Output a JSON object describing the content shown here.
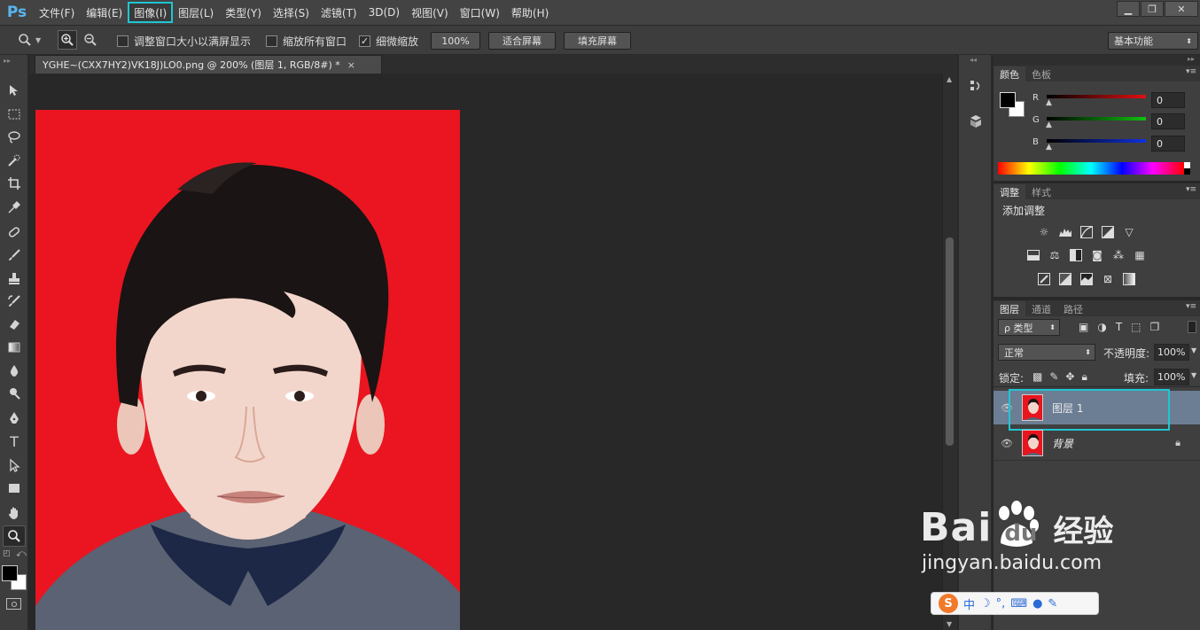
{
  "app": {
    "logo": "Ps"
  },
  "menu": [
    "文件(F)",
    "编辑(E)",
    "图像(I)",
    "图层(L)",
    "类型(Y)",
    "选择(S)",
    "滤镜(T)",
    "3D(D)",
    "视图(V)",
    "窗口(W)",
    "帮助(H)"
  ],
  "menu_highlighted": "图像(I)",
  "window_controls": {
    "minimize": "▁",
    "restore": "❐",
    "close": "✕"
  },
  "options": {
    "resize_windows_label": "调整窗口大小以满屏显示",
    "resize_windows_checked": false,
    "zoom_all_label": "缩放所有窗口",
    "zoom_all_checked": false,
    "scrubby_zoom_label": "细微缩放",
    "scrubby_zoom_checked": true,
    "actual_pixels_button": "100%",
    "fit_screen_button": "适合屏幕",
    "fill_screen_button": "填充屏幕",
    "workspace": "基本功能"
  },
  "document": {
    "tab_title": "YGHE~(CXX7HY2)VK18J)LO0.png @ 200% (图层 1, RGB/8#) *",
    "close": "×"
  },
  "color_panel": {
    "tabs": [
      "颜色",
      "色板"
    ],
    "active_tab": "颜色",
    "foreground": "#000000",
    "background": "#ffffff",
    "sliders": [
      {
        "label": "R",
        "value": "0",
        "color": "#e01010"
      },
      {
        "label": "G",
        "value": "0",
        "color": "#10c010"
      },
      {
        "label": "B",
        "value": "0",
        "color": "#1030e0"
      }
    ]
  },
  "adjustments_panel": {
    "tabs": [
      "调整",
      "样式"
    ],
    "active_tab": "调整",
    "title": "添加调整",
    "rows": [
      [
        "brightness-icon",
        "levels-icon",
        "curves-icon",
        "exposure-icon",
        "vibrance-icon"
      ],
      [
        "hue-saturation-icon",
        "color-balance-icon",
        "black-white-icon",
        "photo-filter-icon",
        "channel-mixer-icon",
        "color-lookup-icon"
      ],
      [
        "invert-icon",
        "posterize-icon",
        "threshold-icon",
        "selective-color-icon",
        "gradient-map-icon"
      ]
    ]
  },
  "layers_panel": {
    "tabs": [
      "图层",
      "通道",
      "路径"
    ],
    "active_tab": "图层",
    "filter_kind": "ρ 类型",
    "blend_mode": "正常",
    "opacity_label": "不透明度:",
    "opacity_value": "100%",
    "lock_label": "锁定:",
    "fill_label": "填充:",
    "fill_value": "100%",
    "layers": [
      {
        "name": "图层 1",
        "selected": true,
        "visible": true,
        "locked": false
      },
      {
        "name": "背景",
        "selected": false,
        "visible": true,
        "locked": true
      }
    ]
  },
  "accent_color": "#1fc6d3",
  "watermark": {
    "brand": "Bai",
    "brand2": "du",
    "suffix": "经验",
    "url": "jingyan.baidu.com"
  },
  "ime": {
    "mode": "中"
  }
}
